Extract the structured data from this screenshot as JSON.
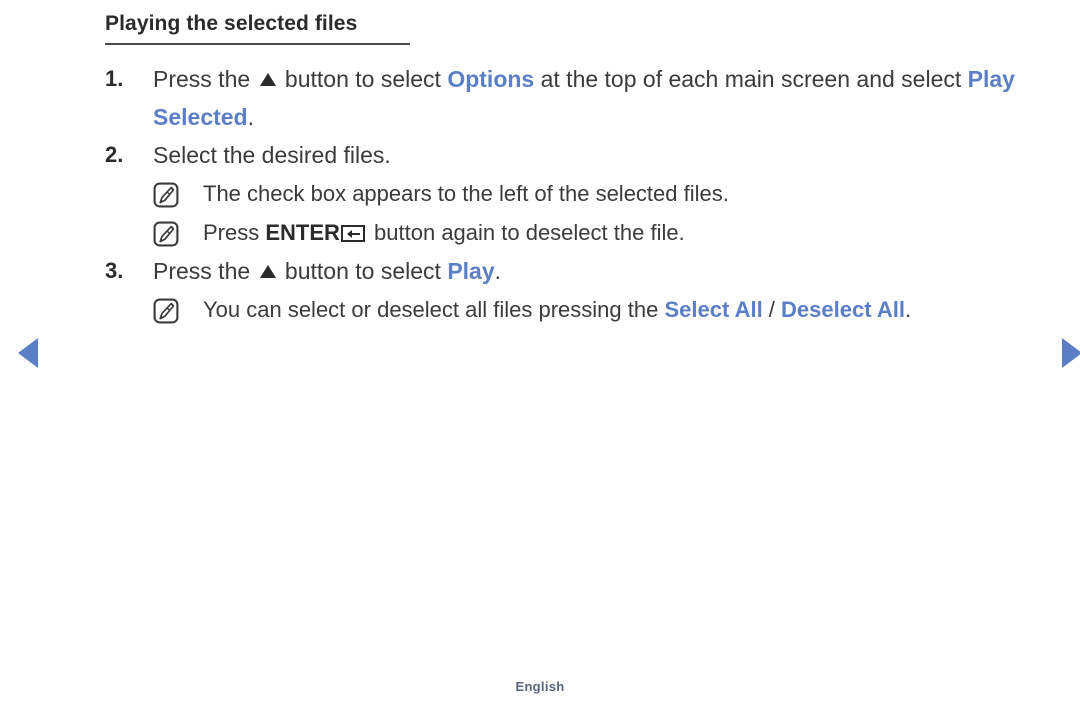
{
  "heading": "Playing the selected files",
  "steps": [
    {
      "number": "1.",
      "segments": [
        {
          "kind": "text",
          "text": "Press the "
        },
        {
          "kind": "icon",
          "icon": "triangle-up-icon"
        },
        {
          "kind": "text",
          "text": " button to select "
        },
        {
          "kind": "blue",
          "text": "Options"
        },
        {
          "kind": "text",
          "text": " at the top of each main screen and select "
        },
        {
          "kind": "blue",
          "text": "Play Selected"
        },
        {
          "kind": "text",
          "text": "."
        }
      ],
      "notes": []
    },
    {
      "number": "2.",
      "segments": [
        {
          "kind": "text",
          "text": "Select the desired files."
        }
      ],
      "notes": [
        {
          "icon": "note-pencil-icon",
          "segments": [
            {
              "kind": "text",
              "text": "The check box appears to the left of the selected files."
            }
          ]
        },
        {
          "icon": "note-pencil-icon",
          "segments": [
            {
              "kind": "text",
              "text": "Press "
            },
            {
              "kind": "bold",
              "text": "ENTER"
            },
            {
              "kind": "icon",
              "icon": "enter-key-icon"
            },
            {
              "kind": "text",
              "text": " button again to deselect the file."
            }
          ]
        }
      ]
    },
    {
      "number": "3.",
      "segments": [
        {
          "kind": "text",
          "text": "Press the "
        },
        {
          "kind": "icon",
          "icon": "triangle-up-icon"
        },
        {
          "kind": "text",
          "text": " button to select "
        },
        {
          "kind": "blue",
          "text": "Play"
        },
        {
          "kind": "text",
          "text": "."
        }
      ],
      "notes": [
        {
          "icon": "note-pencil-icon",
          "segments": [
            {
              "kind": "text",
              "text": "You can select or deselect all files pressing the "
            },
            {
              "kind": "blue",
              "text": "Select All"
            },
            {
              "kind": "slash",
              "text": " / "
            },
            {
              "kind": "blue",
              "text": "Deselect All"
            },
            {
              "kind": "text",
              "text": "."
            }
          ]
        }
      ]
    }
  ],
  "navigation": {
    "prev_label": "previous-page",
    "next_label": "next-page",
    "arrow_color": "#5b7fc7"
  },
  "footer": {
    "language": "English"
  },
  "colors": {
    "accent_blue": "#5b7fc7",
    "body_text": "#3b3b3b",
    "heading_text": "#2b2b2b",
    "footer_text": "#59657e"
  }
}
